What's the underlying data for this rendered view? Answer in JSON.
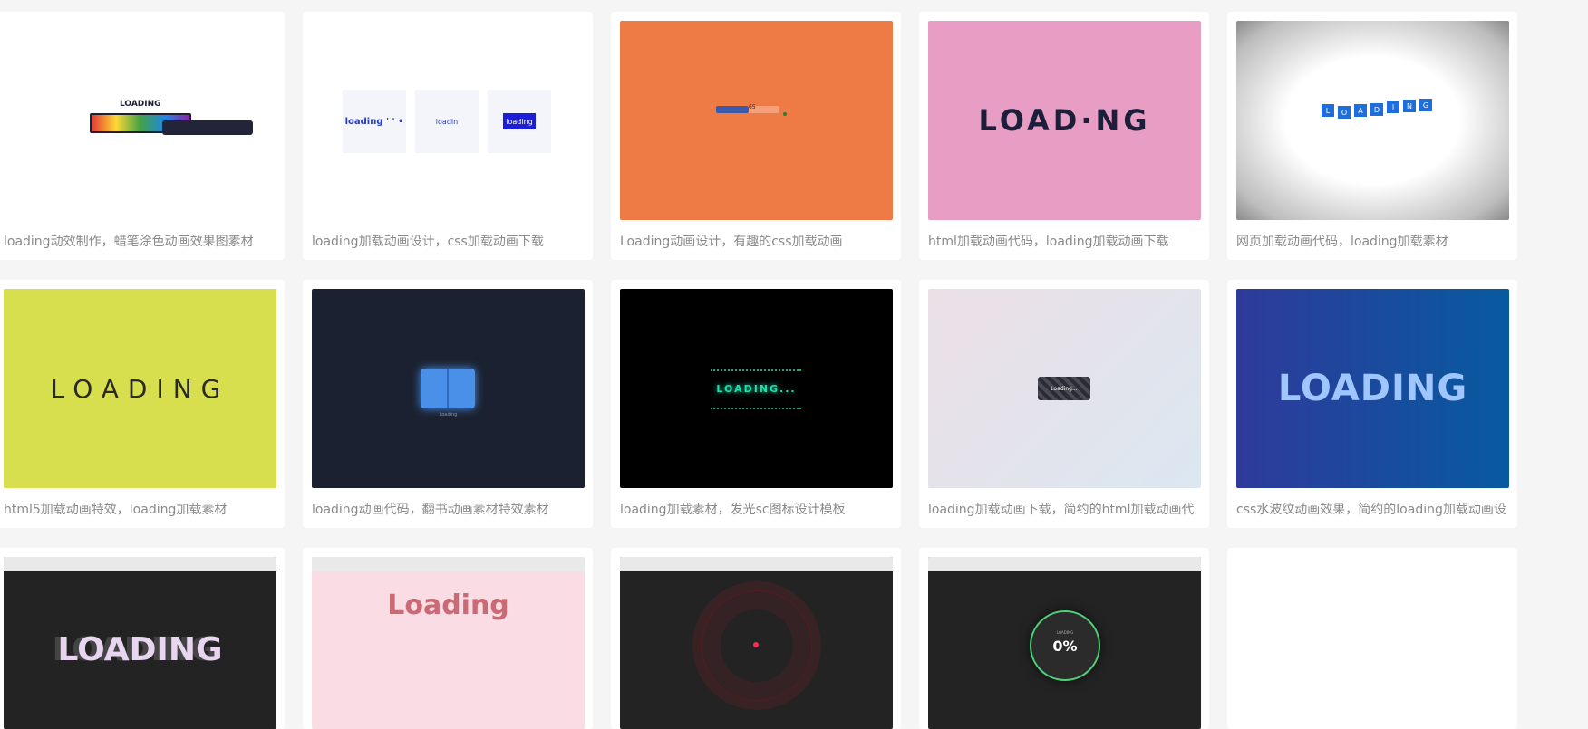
{
  "cards": [
    {
      "caption": "loading动效制作，蜡笔涂色动画效果图素材",
      "thumb_text": "LOADING"
    },
    {
      "caption": "loading加载动画设计，css加载动画下载",
      "thumb_texts": [
        "loading ' ' •",
        "loadin",
        "loading"
      ]
    },
    {
      "caption": "Loading动画设计，有趣的css加载动画",
      "thumb_text": "65"
    },
    {
      "caption": "html加载动画代码，loading加载动画下载",
      "thumb_text": "LOAD·NG"
    },
    {
      "caption": "网页加载动画代码，loading加载素材",
      "thumb_letters": [
        "L",
        "O",
        "A",
        "D",
        "I",
        "N",
        "G"
      ]
    },
    {
      "caption": "html5加载动画特效，loading加载素材",
      "thumb_text": "LOADING"
    },
    {
      "caption": "loading动画代码，翻书动画素材特效素材",
      "thumb_text": "Loading"
    },
    {
      "caption": "loading加载素材，发光sc图标设计模板",
      "thumb_text": "LOADING..."
    },
    {
      "caption": "loading加载动画下载，简约的html加载动画代",
      "thumb_text": "Loading..."
    },
    {
      "caption": "css水波纹动画效果，简约的loading加载动画设",
      "thumb_text": "LOADING"
    },
    {
      "thumb_text": "LOADING"
    },
    {
      "thumb_text": "Loading"
    },
    {
      "thumb_text": ""
    },
    {
      "thumb_text": "0%",
      "thumb_small": "LOADING"
    },
    {
      "thumb_text": ""
    }
  ],
  "colors": {
    "orange": "#ee7a45",
    "pink": "#e79dc4",
    "yellow": "#d8df4e",
    "navy": "#1b2130",
    "black": "#000000",
    "gradient_blue_start": "#2f3a9a",
    "gradient_blue_end": "#075aa0",
    "dark": "#232323",
    "light_pink": "#fadce4"
  }
}
